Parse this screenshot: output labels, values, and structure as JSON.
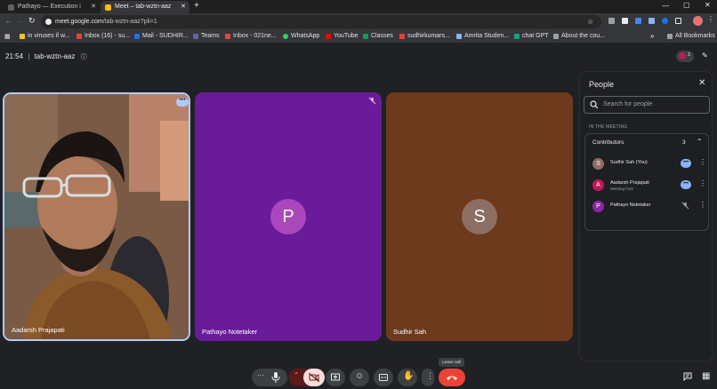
{
  "browser": {
    "tabs": [
      {
        "title": "Pathayo — Execution i",
        "active": false
      },
      {
        "title": "Meet – tab-wztn-aaz",
        "active": true
      }
    ],
    "new_tab_label": "+",
    "url_host": "meet.google.com",
    "url_path": "/tab-wztn-aaz?pli=1",
    "bookmarks": [
      {
        "label": "in viruses if w...",
        "color": "#f6c026"
      },
      {
        "label": "Inbox (16) - su...",
        "color": "#ea4335"
      },
      {
        "label": "Mail - SUDHIR...",
        "color": "#1a73e8"
      },
      {
        "label": "Teams",
        "color": "#6264a7"
      },
      {
        "label": "Inbox - 021ne...",
        "color": "#ea4335"
      },
      {
        "label": "WhatsApp",
        "color": "#25d366"
      },
      {
        "label": "YouTube",
        "color": "#ff0000"
      },
      {
        "label": "Classes",
        "color": "#0f9d58"
      },
      {
        "label": "sudhirkumars...",
        "color": "#ea4335"
      },
      {
        "label": "Amrita Studen...",
        "color": "#8ab4f8"
      },
      {
        "label": "chat GPT",
        "color": "#10a37f"
      },
      {
        "label": "About the cou...",
        "color": "#9aa0a6"
      }
    ],
    "all_bookmarks": "All Bookmarks"
  },
  "meet": {
    "time": "21:54",
    "separator": "|",
    "meeting_code": "tab-wztn-aaz",
    "participant_count": "3",
    "tiles": [
      {
        "name": "Aadarsh Prajapati",
        "type": "video"
      },
      {
        "name": "Pathayo Notetaker",
        "initial": "P",
        "bg": "#6a1b9a",
        "avatar_bg": "#ab47bc"
      },
      {
        "name": "Sudhir Sah",
        "initial": "S",
        "bg": "#6d3a1e",
        "avatar_bg": "#8d6e63"
      }
    ],
    "tooltip": "Leave call"
  },
  "panel": {
    "title": "People",
    "search_placeholder": "Search for people",
    "section_label": "IN THE MEETING",
    "contributors_label": "Contributors",
    "contributors_count": "3",
    "people": [
      {
        "initial": "S",
        "name": "Sudhir Sah (You)",
        "subtitle": "",
        "avatar_color": "#8d6e63"
      },
      {
        "initial": "A",
        "name": "Aadarsh Prajapati",
        "subtitle": "Meeting host",
        "avatar_color": "#c2185b"
      },
      {
        "initial": "P",
        "name": "Pathayo Notetaker",
        "subtitle": "",
        "avatar_color": "#8e24aa"
      }
    ]
  },
  "colors": {
    "leave_red": "#ea4335",
    "active_border": "#aecbfa"
  }
}
